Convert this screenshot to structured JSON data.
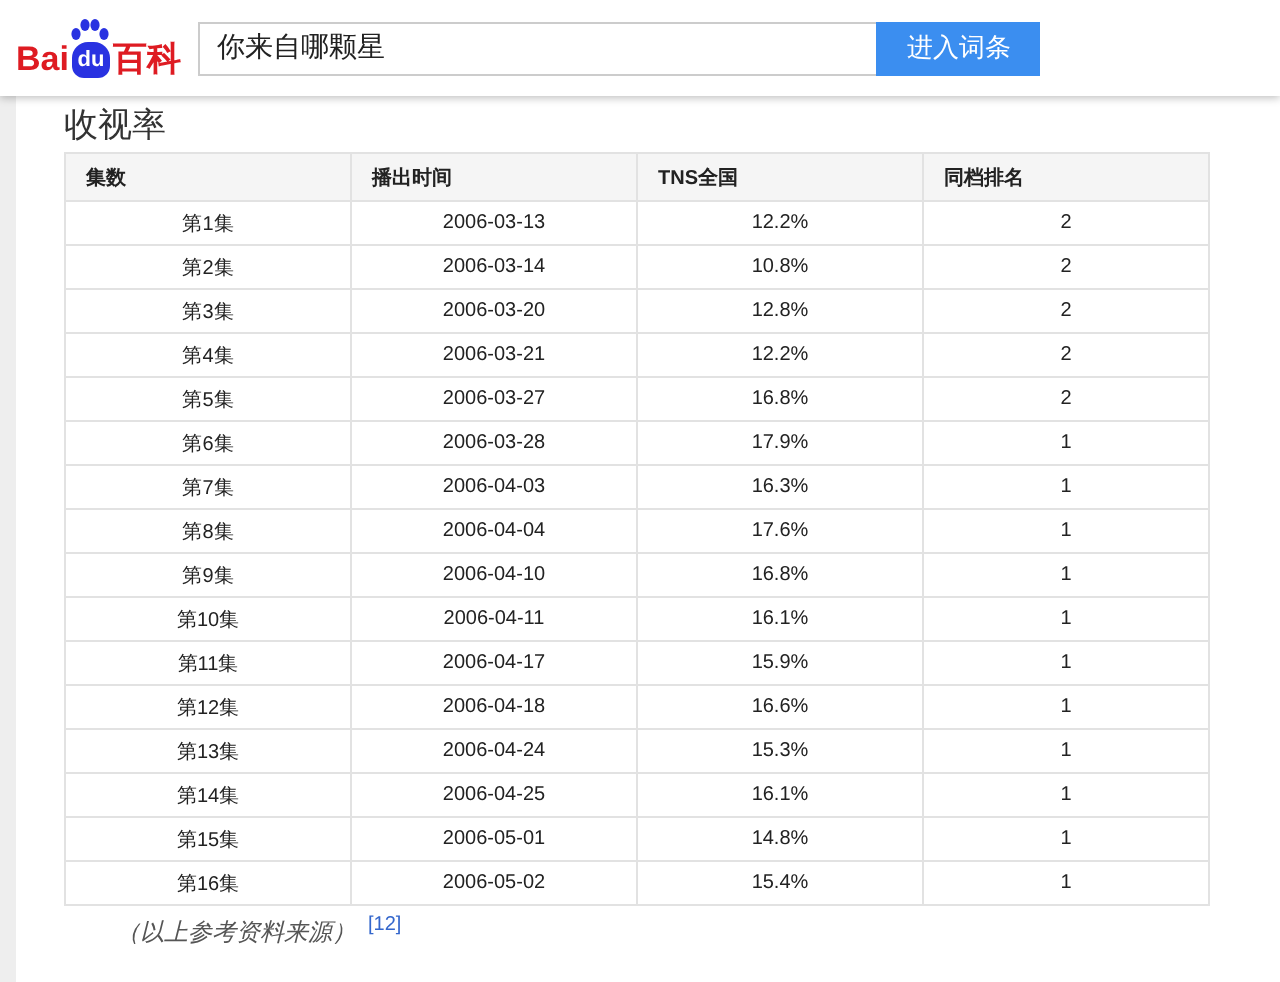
{
  "header": {
    "logo": {
      "left": "Bai",
      "paw": "du",
      "right": "百科"
    },
    "search": {
      "value": "你来自哪颗星"
    },
    "button": "进入词条"
  },
  "section": {
    "title": "收视率"
  },
  "table": {
    "columns": [
      "集数",
      "播出时间",
      "TNS全国",
      "同档排名"
    ],
    "rows": [
      [
        "第1集",
        "2006-03-13",
        "12.2%",
        "2"
      ],
      [
        "第2集",
        "2006-03-14",
        "10.8%",
        "2"
      ],
      [
        "第3集",
        "2006-03-20",
        "12.8%",
        "2"
      ],
      [
        "第4集",
        "2006-03-21",
        "12.2%",
        "2"
      ],
      [
        "第5集",
        "2006-03-27",
        "16.8%",
        "2"
      ],
      [
        "第6集",
        "2006-03-28",
        "17.9%",
        "1"
      ],
      [
        "第7集",
        "2006-04-03",
        "16.3%",
        "1"
      ],
      [
        "第8集",
        "2006-04-04",
        "17.6%",
        "1"
      ],
      [
        "第9集",
        "2006-04-10",
        "16.8%",
        "1"
      ],
      [
        "第10集",
        "2006-04-11",
        "16.1%",
        "1"
      ],
      [
        "第11集",
        "2006-04-17",
        "15.9%",
        "1"
      ],
      [
        "第12集",
        "2006-04-18",
        "16.6%",
        "1"
      ],
      [
        "第13集",
        "2006-04-24",
        "15.3%",
        "1"
      ],
      [
        "第14集",
        "2006-04-25",
        "16.1%",
        "1"
      ],
      [
        "第15集",
        "2006-05-01",
        "14.8%",
        "1"
      ],
      [
        "第16集",
        "2006-05-02",
        "15.4%",
        "1"
      ]
    ]
  },
  "footnote": {
    "text": "（以上参考资料来源）",
    "ref": "[12]"
  }
}
